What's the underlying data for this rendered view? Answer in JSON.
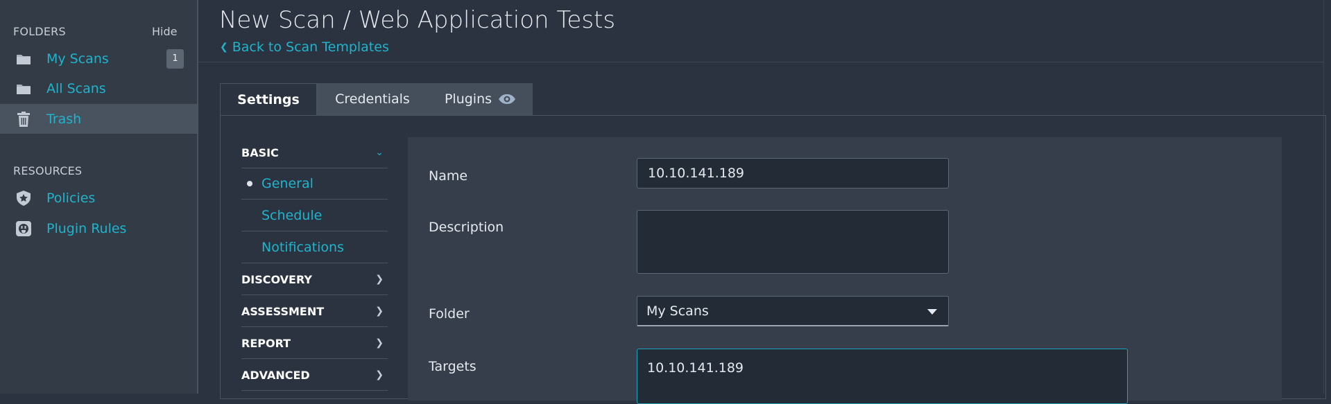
{
  "sidebar": {
    "folders_heading": "FOLDERS",
    "hide_label": "Hide",
    "folders": [
      {
        "label": "My Scans",
        "icon": "folder-icon",
        "badge": "1"
      },
      {
        "label": "All Scans",
        "icon": "folder-icon"
      },
      {
        "label": "Trash",
        "icon": "trash-icon",
        "active": true
      }
    ],
    "resources_heading": "RESOURCES",
    "resources": [
      {
        "label": "Policies",
        "icon": "shield-star-icon"
      },
      {
        "label": "Plugin Rules",
        "icon": "plug-icon"
      }
    ]
  },
  "header": {
    "title": "New Scan / Web Application Tests",
    "back_link": "Back to Scan Templates"
  },
  "tabs": [
    {
      "label": "Settings",
      "active": true
    },
    {
      "label": "Credentials"
    },
    {
      "label": "Plugins",
      "icon": "eye-icon"
    }
  ],
  "settings_nav": {
    "basic": "BASIC",
    "basic_items": [
      "General",
      "Schedule",
      "Notifications"
    ],
    "discovery": "DISCOVERY",
    "assessment": "ASSESSMENT",
    "report": "REPORT",
    "advanced": "ADVANCED"
  },
  "form": {
    "name_label": "Name",
    "name_value": "10.10.141.189",
    "description_label": "Description",
    "description_value": "",
    "folder_label": "Folder",
    "folder_value": "My Scans",
    "targets_label": "Targets",
    "targets_value": "10.10.141.189"
  },
  "colors": {
    "accent": "#1fb4cc",
    "sidebar_bg": "#333b46",
    "page_bg": "#2b3340",
    "form_bg": "#353e4a",
    "input_bg": "#232b37"
  }
}
